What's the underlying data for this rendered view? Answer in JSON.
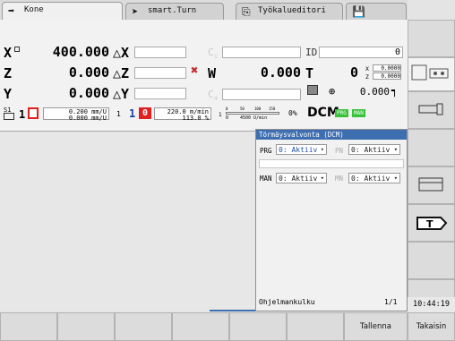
{
  "tabs": [
    {
      "label": "Kone",
      "icon": "arrow-right-icon"
    },
    {
      "label": "smart.Turn",
      "icon": "smart-turn-icon"
    },
    {
      "label": "Työkalueditori",
      "icon": "tool-editor-icon"
    },
    {
      "label": "",
      "icon": "save-icon"
    }
  ],
  "status": {
    "x_label": "X",
    "x_value": "400.000",
    "dx_label": "△X",
    "z_label": "Z",
    "z_value": "0.000",
    "dz_label": "△Z",
    "y_label": "Y",
    "y_value": "0.000",
    "dy_label": "△Y",
    "c1_label": "C",
    "c1_sub": "1",
    "w_label": "W",
    "w_value": "0.000",
    "c4_label": "C",
    "c4_sub": "4",
    "id_label": "ID",
    "id_value": "0",
    "t_label": "T",
    "t_value": "0",
    "t_x_label": "X",
    "t_x_value": "0.0000",
    "t_z_label": "Z",
    "t_z_value": "0.0000",
    "spindle_value": "0.000",
    "s1_label": "S1",
    "s1_num": "1",
    "feed1": "0.200 mm/U",
    "feed2": "0.000 mm/U",
    "one_a": "1",
    "one_b": "1",
    "zero": "0",
    "speed1": "220.0 m/min",
    "speed2": "113.0 %",
    "scale_ticks": [
      "0",
      "50",
      "100",
      "150"
    ],
    "scale_left": "1",
    "scale_zero": "0",
    "scale_value": "4500 U/min",
    "pct_label": "0%",
    "dcm_label": "DCM",
    "prg_badge": "PRG",
    "man_badge": "MAN"
  },
  "dialog": {
    "title": "Törmäysvalvonta (DCM)",
    "prg_label": "PRG",
    "prg_value": "0: Aktiiv",
    "pn_label": "PN",
    "pn_value": "0: Aktiiv",
    "man_label": "MAN",
    "man_value": "0: Aktiiv",
    "mn_label": "MN",
    "mn_value": "0: Aktiiv",
    "footer_label": "Ohjelmankulku",
    "page": "1/1"
  },
  "clock": "10:44:19",
  "softkeys": {
    "save": "Tallenna",
    "back": "Takaisin"
  },
  "colors": {
    "accent": "#3d6fb0",
    "alarm_red": "#e02020",
    "badge_green": "#36c23a"
  }
}
